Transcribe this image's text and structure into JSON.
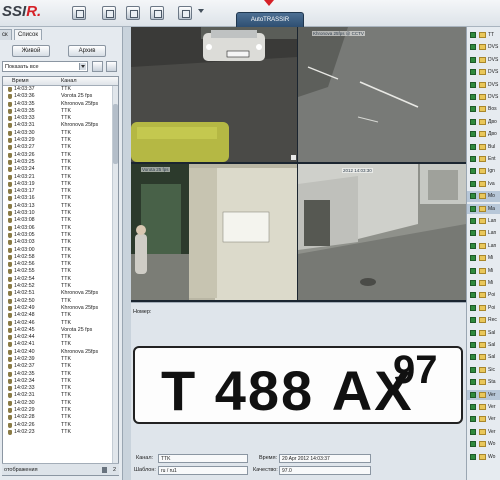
{
  "app": {
    "logo_main": "SSI",
    "logo_accent": "R.",
    "server_tab": "AutoTRASSIR"
  },
  "left_panel": {
    "tabs": [
      "ск",
      "Список"
    ],
    "btn_live": "Живой",
    "btn_archive": "Архив",
    "filter_value": "Показать все",
    "col_time": "Время",
    "col_channel": "Канал",
    "rows": [
      {
        "time": "14:03:37",
        "channel": "TTK"
      },
      {
        "time": "14:03:36",
        "channel": "Vorota 25 fps"
      },
      {
        "time": "14:03:35",
        "channel": "Khronova 25fps"
      },
      {
        "time": "14:03:35",
        "channel": "TTK"
      },
      {
        "time": "14:03:33",
        "channel": "TTK"
      },
      {
        "time": "14:03:31",
        "channel": "Khronova 25fps"
      },
      {
        "time": "14:03:30",
        "channel": "TTK"
      },
      {
        "time": "14:03:29",
        "channel": "TTK"
      },
      {
        "time": "14:03:27",
        "channel": "TTK"
      },
      {
        "time": "14:03:26",
        "channel": "TTK"
      },
      {
        "time": "14:03:25",
        "channel": "TTK"
      },
      {
        "time": "14:03:24",
        "channel": "TTK"
      },
      {
        "time": "14:03:21",
        "channel": "TTK"
      },
      {
        "time": "14:03:19",
        "channel": "TTK"
      },
      {
        "time": "14:03:17",
        "channel": "TTK"
      },
      {
        "time": "14:03:16",
        "channel": "TTK"
      },
      {
        "time": "14:03:13",
        "channel": "TTK"
      },
      {
        "time": "14:03:10",
        "channel": "TTK"
      },
      {
        "time": "14:03:08",
        "channel": "TTK"
      },
      {
        "time": "14:03:06",
        "channel": "TTK"
      },
      {
        "time": "14:03:05",
        "channel": "TTK"
      },
      {
        "time": "14:03:03",
        "channel": "TTK"
      },
      {
        "time": "14:03:00",
        "channel": "TTK"
      },
      {
        "time": "14:02:58",
        "channel": "TTK"
      },
      {
        "time": "14:02:56",
        "channel": "TTK"
      },
      {
        "time": "14:02:55",
        "channel": "TTK"
      },
      {
        "time": "14:02:54",
        "channel": "TTK"
      },
      {
        "time": "14:02:52",
        "channel": "TTK"
      },
      {
        "time": "14:02:51",
        "channel": "Khronova 25fps"
      },
      {
        "time": "14:02:50",
        "channel": "TTK"
      },
      {
        "time": "14:02:49",
        "channel": "Khronova 25fps"
      },
      {
        "time": "14:02:48",
        "channel": "TTK"
      },
      {
        "time": "14:02:46",
        "channel": "TTK"
      },
      {
        "time": "14:02:45",
        "channel": "Vorota 25 fps"
      },
      {
        "time": "14:02:44",
        "channel": "TTK"
      },
      {
        "time": "14:02:41",
        "channel": "TTK"
      },
      {
        "time": "14:02:40",
        "channel": "Khronova 25fps"
      },
      {
        "time": "14:02:39",
        "channel": "TTK"
      },
      {
        "time": "14:02:37",
        "channel": "TTK"
      },
      {
        "time": "14:02:35",
        "channel": "TTK"
      },
      {
        "time": "14:02:34",
        "channel": "TTK"
      },
      {
        "time": "14:02:33",
        "channel": "TTK"
      },
      {
        "time": "14:02:31",
        "channel": "TTK"
      },
      {
        "time": "14:02:30",
        "channel": "TTK"
      },
      {
        "time": "14:02:29",
        "channel": "TTK"
      },
      {
        "time": "14:02:28",
        "channel": "TTK"
      },
      {
        "time": "14:02:26",
        "channel": "TTK"
      },
      {
        "time": "14:02:23",
        "channel": "TTK"
      }
    ],
    "status_label": "отображения",
    "status_count": "2"
  },
  "cameras": {
    "cam2_ts": "Khronova 25fps @ CCTV",
    "cam3_ts": "Vorota 25 fps",
    "cam4_ts": "2012 14:03:30"
  },
  "plate_panel": {
    "number_label": "Номер:",
    "plate_main": "Т 488 АХ",
    "plate_region": "97",
    "channel_label": "Канал:",
    "channel_value": "TTK",
    "time_label": "Время:",
    "time_value": "20 Apr 2012 14:03:37",
    "template_label": "Шаблон:",
    "template_value": "ru / ru1",
    "quality_label": "Качество:",
    "quality_value": "97.0"
  },
  "right_panel": {
    "items": [
      "TT",
      "DVS",
      "DVS",
      "DVS",
      "DVS",
      "DVS",
      "Bos",
      "Дво",
      "Дво",
      "Bul",
      "Ent",
      "Ign",
      "Iva",
      "Mo",
      "Ma",
      "Lan",
      "Lan",
      "Lan",
      "Mi",
      "Mi",
      "Mi",
      "Poi",
      "Poi",
      "Rec",
      "Sal",
      "Sal",
      "Sal",
      "Sic",
      "Sta",
      "Ver",
      "Ver",
      "Ver",
      "Ver",
      "Wo",
      "Wo"
    ]
  },
  "colors": {
    "server_tab": "#2e4f72",
    "accent_red": "#d62027",
    "checkbox_green": "#2f8a3d"
  }
}
